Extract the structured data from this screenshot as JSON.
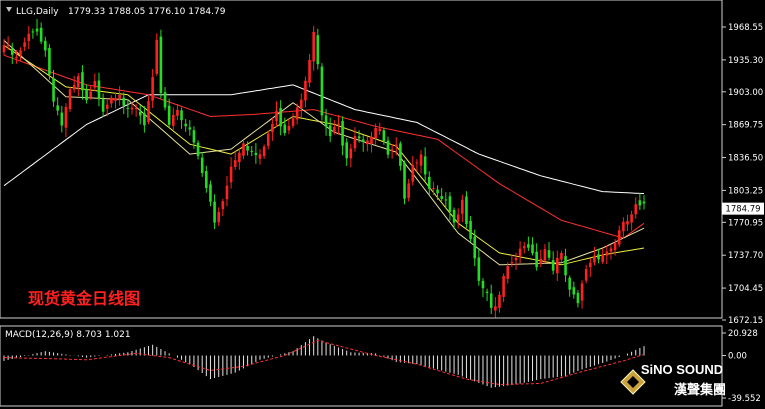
{
  "chart_data": [
    {
      "type": "candlestick",
      "title": "LLG,Daily",
      "ohlc_header": "1779.33 1788.05 1776.10 1784.79",
      "annotation": "现货黄金日线图",
      "y_ticks": [
        "1968.55",
        "1935.30",
        "1903.00",
        "1869.75",
        "1836.50",
        "1803.25",
        "1770.95",
        "1737.70",
        "1704.45",
        "1672.15"
      ],
      "y_tick_values": [
        1968.55,
        1935.3,
        1903.0,
        1869.75,
        1836.5,
        1803.25,
        1770.95,
        1737.7,
        1704.45,
        1672.15
      ],
      "ylim": [
        1672.15,
        1968.55
      ],
      "current_price_label": "1784.79",
      "colors": {
        "up": "#ff2020",
        "down": "#22dd22",
        "ma_white": "#ffffff",
        "ma_red": "#ff3030",
        "ma_yellow": "#eeee44",
        "ma_khaki": "#e8e0a0"
      },
      "close_keypoints": [
        [
          0,
          1950
        ],
        [
          3,
          1935
        ],
        [
          6,
          1958
        ],
        [
          8,
          1968
        ],
        [
          10,
          1945
        ],
        [
          12,
          1898
        ],
        [
          14,
          1870
        ],
        [
          16,
          1900
        ],
        [
          18,
          1915
        ],
        [
          20,
          1890
        ],
        [
          22,
          1910
        ],
        [
          24,
          1888
        ],
        [
          26,
          1900
        ],
        [
          28,
          1905
        ],
        [
          30,
          1880
        ],
        [
          32,
          1885
        ],
        [
          34,
          1868
        ],
        [
          36,
          1912
        ],
        [
          37,
          1950
        ],
        [
          38,
          1905
        ],
        [
          40,
          1872
        ],
        [
          42,
          1888
        ],
        [
          44,
          1870
        ],
        [
          46,
          1850
        ],
        [
          48,
          1820
        ],
        [
          50,
          1790
        ],
        [
          51,
          1770
        ],
        [
          53,
          1795
        ],
        [
          55,
          1828
        ],
        [
          58,
          1855
        ],
        [
          60,
          1842
        ],
        [
          62,
          1835
        ],
        [
          64,
          1860
        ],
        [
          66,
          1880
        ],
        [
          68,
          1865
        ],
        [
          70,
          1880
        ],
        [
          72,
          1900
        ],
        [
          74,
          1940
        ],
        [
          75,
          1960
        ],
        [
          76,
          1930
        ],
        [
          77,
          1875
        ],
        [
          79,
          1858
        ],
        [
          81,
          1868
        ],
        [
          83,
          1840
        ],
        [
          85,
          1862
        ],
        [
          87,
          1856
        ],
        [
          89,
          1858
        ],
        [
          91,
          1865
        ],
        [
          93,
          1835
        ],
        [
          95,
          1845
        ],
        [
          97,
          1800
        ],
        [
          99,
          1832
        ],
        [
          101,
          1840
        ],
        [
          103,
          1810
        ],
        [
          105,
          1795
        ],
        [
          107,
          1790
        ],
        [
          109,
          1765
        ],
        [
          111,
          1790
        ],
        [
          113,
          1760
        ],
        [
          115,
          1715
        ],
        [
          117,
          1700
        ],
        [
          118,
          1688
        ],
        [
          119,
          1680
        ],
        [
          121,
          1712
        ],
        [
          123,
          1730
        ],
        [
          125,
          1740
        ],
        [
          127,
          1750
        ],
        [
          129,
          1730
        ],
        [
          131,
          1745
        ],
        [
          133,
          1728
        ],
        [
          135,
          1735
        ],
        [
          137,
          1698
        ],
        [
          139,
          1688
        ],
        [
          141,
          1725
        ],
        [
          143,
          1738
        ],
        [
          145,
          1740
        ],
        [
          147,
          1745
        ],
        [
          149,
          1760
        ],
        [
          151,
          1772
        ],
        [
          153,
          1785
        ],
        [
          155,
          1784.79
        ]
      ],
      "moving_averages": [
        {
          "color": "white",
          "points": [
            [
              0,
              1808
            ],
            [
              20,
              1870
            ],
            [
              35,
              1900
            ],
            [
              55,
              1900
            ],
            [
              70,
              1910
            ],
            [
              85,
              1885
            ],
            [
              100,
              1872
            ],
            [
              115,
              1840
            ],
            [
              130,
              1818
            ],
            [
              145,
              1802
            ],
            [
              155,
              1800
            ]
          ]
        },
        {
          "color": "red",
          "points": [
            [
              0,
              1940
            ],
            [
              20,
              1910
            ],
            [
              35,
              1900
            ],
            [
              50,
              1878
            ],
            [
              60,
              1880
            ],
            [
              75,
              1885
            ],
            [
              90,
              1868
            ],
            [
              105,
              1855
            ],
            [
              120,
              1810
            ],
            [
              135,
              1773
            ],
            [
              150,
              1755
            ],
            [
              155,
              1770
            ]
          ]
        },
        {
          "color": "yellow",
          "points": [
            [
              0,
              1950
            ],
            [
              15,
              1908
            ],
            [
              30,
              1900
            ],
            [
              45,
              1850
            ],
            [
              55,
              1840
            ],
            [
              70,
              1878
            ],
            [
              80,
              1870
            ],
            [
              95,
              1848
            ],
            [
              110,
              1770
            ],
            [
              120,
              1740
            ],
            [
              135,
              1728
            ],
            [
              145,
              1738
            ],
            [
              155,
              1745
            ]
          ]
        },
        {
          "color": "khaki",
          "points": [
            [
              0,
              1955
            ],
            [
              15,
              1898
            ],
            [
              30,
              1895
            ],
            [
              45,
              1840
            ],
            [
              55,
              1845
            ],
            [
              70,
              1892
            ],
            [
              80,
              1862
            ],
            [
              95,
              1842
            ],
            [
              110,
              1760
            ],
            [
              120,
              1728
            ],
            [
              135,
              1730
            ],
            [
              145,
              1745
            ],
            [
              155,
              1765
            ]
          ]
        }
      ],
      "macd": {
        "label": "MACD(12,26,9) 8.703 1.021",
        "y_ticks": [
          "20.928",
          "0.00",
          "-39.552"
        ],
        "ylim": [
          -39.552,
          20.928
        ],
        "hist_keypoints": [
          [
            0,
            -5
          ],
          [
            10,
            4
          ],
          [
            20,
            -2
          ],
          [
            30,
            3
          ],
          [
            36,
            10
          ],
          [
            45,
            -8
          ],
          [
            50,
            -22
          ],
          [
            56,
            -16
          ],
          [
            62,
            -4
          ],
          [
            70,
            4
          ],
          [
            75,
            18
          ],
          [
            78,
            12
          ],
          [
            84,
            3
          ],
          [
            90,
            2
          ],
          [
            95,
            -6
          ],
          [
            100,
            -8
          ],
          [
            110,
            -18
          ],
          [
            118,
            -30
          ],
          [
            124,
            -27
          ],
          [
            130,
            -22
          ],
          [
            136,
            -19
          ],
          [
            140,
            -13
          ],
          [
            145,
            -7
          ],
          [
            150,
            0
          ],
          [
            155,
            8.7
          ]
        ],
        "signal_keypoints": [
          [
            0,
            -2
          ],
          [
            12,
            -3
          ],
          [
            20,
            -4
          ],
          [
            32,
            2
          ],
          [
            40,
            -2
          ],
          [
            50,
            -14
          ],
          [
            58,
            -10
          ],
          [
            68,
            0
          ],
          [
            76,
            14
          ],
          [
            82,
            8
          ],
          [
            90,
            0
          ],
          [
            100,
            -8
          ],
          [
            112,
            -22
          ],
          [
            120,
            -27
          ],
          [
            130,
            -26
          ],
          [
            140,
            -15
          ],
          [
            150,
            -5
          ],
          [
            155,
            1.0
          ]
        ]
      }
    }
  ],
  "logo": {
    "main": "SiNO SOUND",
    "sub": "漢聲集團"
  }
}
